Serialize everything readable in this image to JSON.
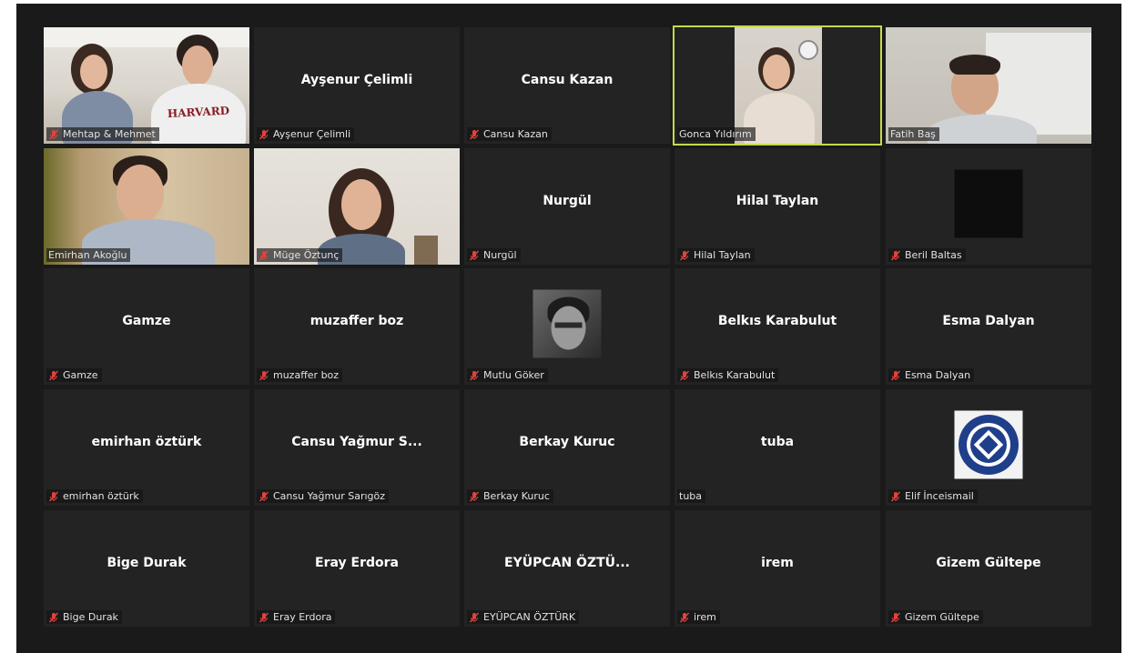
{
  "colors": {
    "background": "#1a1a1a",
    "tile": "#232323",
    "speaker_border": "#c7d94a",
    "muted": "#e0433d"
  },
  "participants": [
    {
      "label": "Mehtap & Mehmet",
      "muted": true,
      "video": true,
      "hoodie_text": "HARVARD"
    },
    {
      "name": "Ayşenur Çelimli",
      "label": "Ayşenur Çelimli",
      "muted": true
    },
    {
      "name": "Cansu Kazan",
      "label": "Cansu Kazan",
      "muted": true
    },
    {
      "label": "Gonca Yıldırım",
      "muted": false,
      "video": true,
      "speaking": true
    },
    {
      "label": "Fatih Baş",
      "muted": false,
      "video": true
    },
    {
      "label": "Emirhan Akoğlu",
      "muted": false,
      "video": true
    },
    {
      "label": "Müge Öztunç",
      "muted": true,
      "video": true
    },
    {
      "name": "Nurgül",
      "label": "Nurgül",
      "muted": true
    },
    {
      "name": "Hilal Taylan",
      "label": "Hilal Taylan",
      "muted": true
    },
    {
      "label": "Beril Baltas",
      "muted": true,
      "avatar": "black-square"
    },
    {
      "name": "Gamze",
      "label": "Gamze",
      "muted": true
    },
    {
      "name": "muzaffer boz",
      "label": "muzaffer boz",
      "muted": true
    },
    {
      "label": "Mutlu Göker",
      "muted": true,
      "avatar": "photo"
    },
    {
      "name": "Belkıs Karabulut",
      "label": "Belkıs Karabulut",
      "muted": true
    },
    {
      "name": "Esma Dalyan",
      "label": "Esma Dalyan",
      "muted": true
    },
    {
      "name": "emirhan öztürk",
      "label": "emirhan öztürk",
      "muted": true
    },
    {
      "name": "Cansu Yağmur S...",
      "label": "Cansu Yağmur Sarıgöz",
      "muted": true
    },
    {
      "name": "Berkay Kuruc",
      "label": "Berkay Kuruc",
      "muted": true
    },
    {
      "name": "tuba",
      "label": "tuba",
      "muted": false
    },
    {
      "label": "Elif İnceismail",
      "muted": true,
      "avatar": "logo"
    },
    {
      "name": "Bige Durak",
      "label": "Bige Durak",
      "muted": true
    },
    {
      "name": "Eray Erdora",
      "label": "Eray Erdora",
      "muted": true
    },
    {
      "name": "EYÜPCAN ÖZTÜ...",
      "label": "EYÜPCAN ÖZTÜRK",
      "muted": true
    },
    {
      "name": "irem",
      "label": "irem",
      "muted": true
    },
    {
      "name": "Gizem Gültepe",
      "label": "Gizem Gültepe",
      "muted": true
    }
  ]
}
